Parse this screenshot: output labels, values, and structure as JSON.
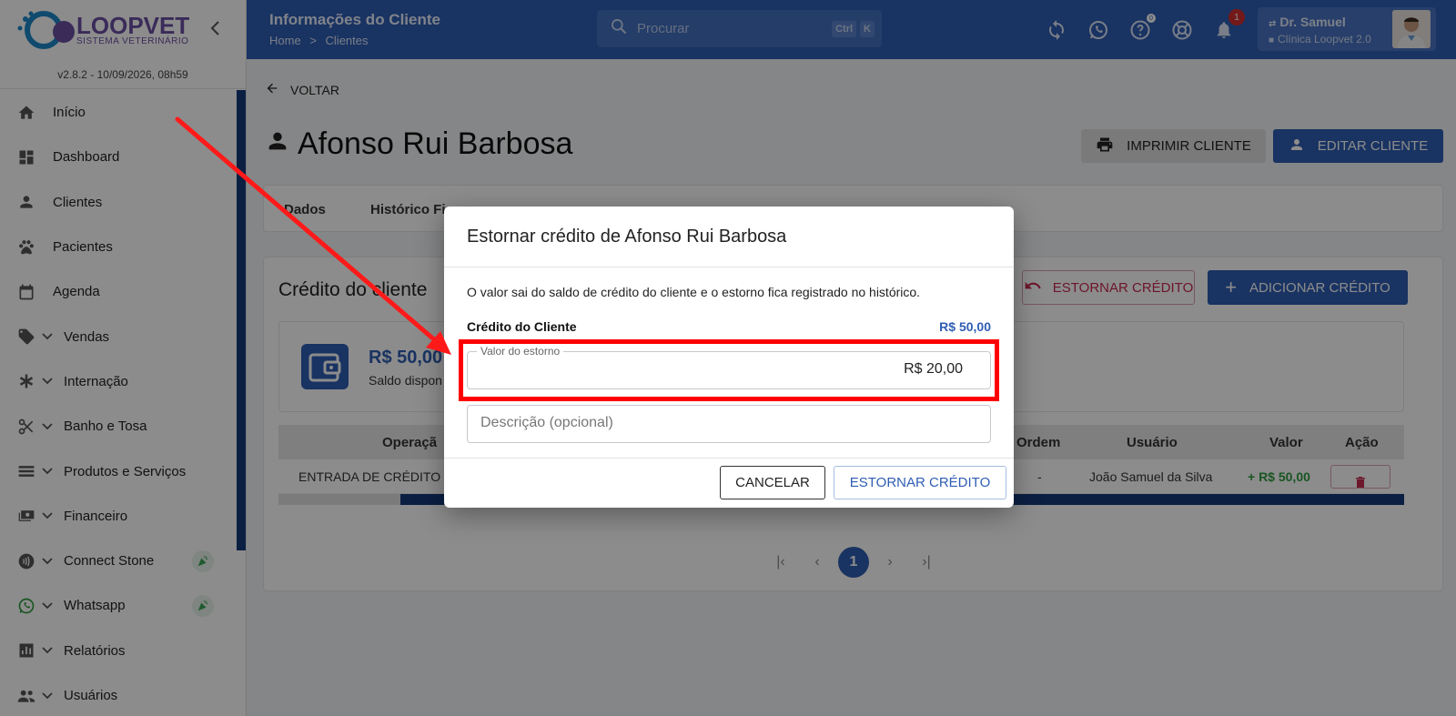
{
  "sidebar": {
    "brand": "LOOPVET",
    "brand_sub": "SISTEMA VETERINÁRIO",
    "version": "v2.8.2 - 10/09/2026, 08h59",
    "items": [
      {
        "label": "Início",
        "icon": "home-icon"
      },
      {
        "label": "Dashboard",
        "icon": "dashboard-icon"
      },
      {
        "label": "Clientes",
        "icon": "person-icon"
      },
      {
        "label": "Pacientes",
        "icon": "paw-icon"
      },
      {
        "label": "Agenda",
        "icon": "calendar-icon"
      },
      {
        "label": "Vendas",
        "icon": "tag-icon"
      },
      {
        "label": "Internação",
        "icon": "asterisk-icon"
      },
      {
        "label": "Banho e Tosa",
        "icon": "scissors-icon"
      },
      {
        "label": "Produtos e Serviços",
        "icon": "list-icon"
      },
      {
        "label": "Financeiro",
        "icon": "money-icon"
      },
      {
        "label": "Connect Stone",
        "icon": "contactless-icon"
      },
      {
        "label": "Whatsapp",
        "icon": "whatsapp-icon"
      },
      {
        "label": "Relatórios",
        "icon": "bar-chart-icon"
      },
      {
        "label": "Usuários",
        "icon": "group-icon"
      }
    ]
  },
  "header": {
    "title": "Informações do Cliente",
    "breadcrumb_home": "Home",
    "breadcrumb_sep": ">",
    "breadcrumb_current": "Clientes",
    "search_placeholder": "Procurar",
    "kbd_ctrl": "Ctrl",
    "kbd_k": "K",
    "help_badge": "0",
    "notifications_badge": "1",
    "user_name": "Dr. Samuel",
    "user_clinic": "Clínica Loopvet 2.0"
  },
  "main": {
    "back_label": "VOLTAR",
    "client_name": "Afonso Rui Barbosa",
    "print_label": "IMPRIMIR CLIENTE",
    "edit_label": "EDITAR CLIENTE",
    "tabs": [
      "Dados",
      "Histórico Fi"
    ],
    "credit_title": "Crédito do cliente",
    "reverse_label": "ESTORNAR CRÉDITO",
    "add_label": "ADICIONAR CRÉDITO",
    "balance_value": "R$ 50,00",
    "balance_label": "Saldo dispon",
    "table_headers": {
      "operation": "Operaçã",
      "order": "Ordem",
      "user": "Usuário",
      "value": "Valor",
      "action": "Ação"
    },
    "rows": [
      {
        "operation": "ENTRADA DE CRÉDITO",
        "order": "-",
        "user": "João Samuel da Silva",
        "value": "+ R$ 50,00"
      }
    ],
    "page": "1"
  },
  "modal": {
    "title": "Estornar crédito de Afonso Rui Barbosa",
    "description": "O valor sai do saldo de crédito do cliente e o estorno fica registrado no histórico.",
    "credit_label": "Crédito do Cliente",
    "credit_value": "R$ 50,00",
    "amount_label": "Valor do estorno",
    "amount_value": "R$ 20,00",
    "desc_placeholder": "Descrição (opcional)",
    "cancel_label": "CANCELAR",
    "confirm_label": "ESTORNAR CRÉDITO"
  },
  "colors": {
    "primary": "#2f5db3",
    "danger": "#c62850",
    "highlight": "#ff0000",
    "success": "#2e9b3e"
  }
}
